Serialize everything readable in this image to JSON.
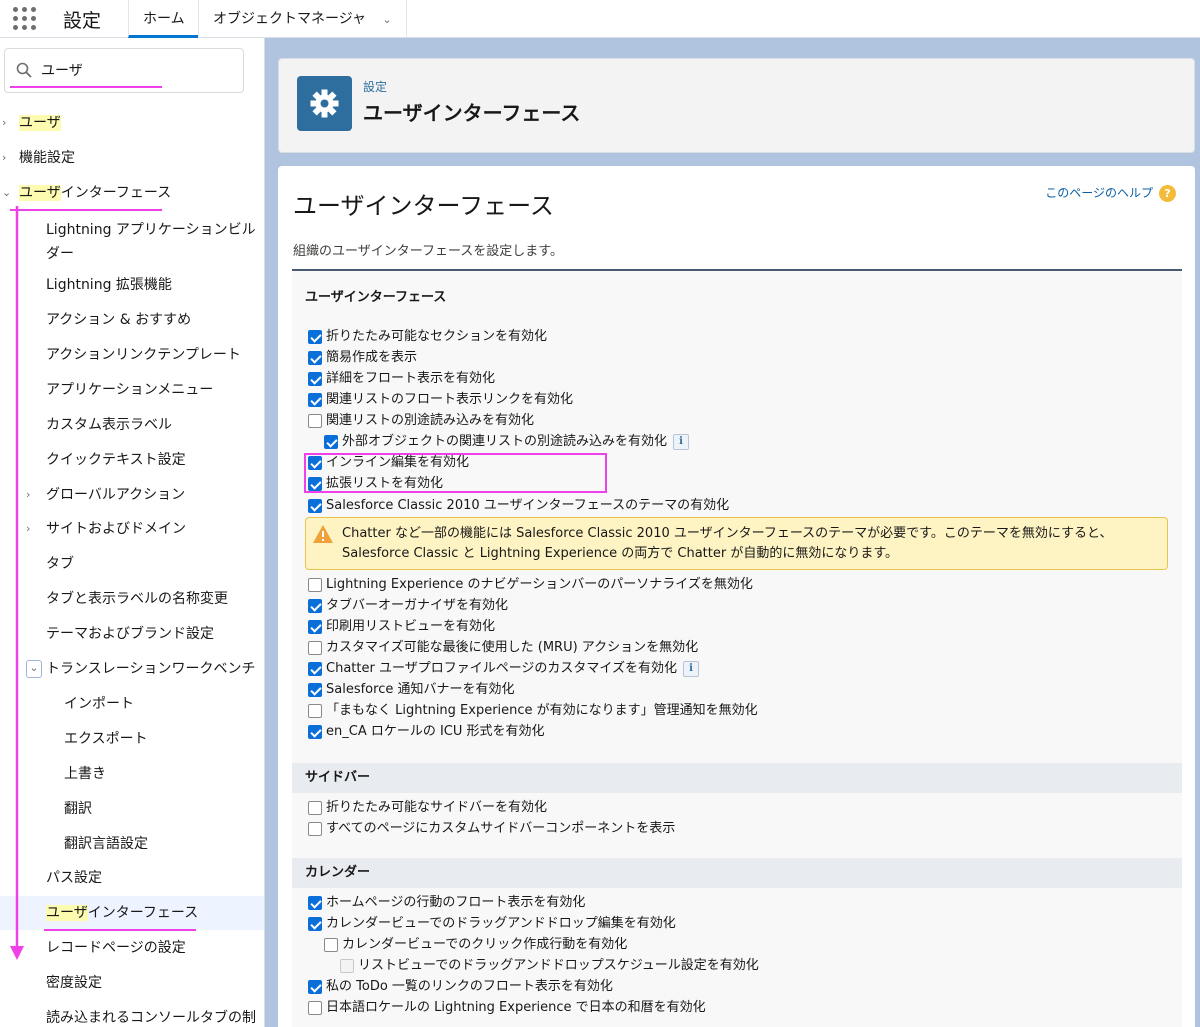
{
  "topbar": {
    "title": "設定",
    "tabs": [
      "ホーム",
      "オブジェクトマネージャ"
    ]
  },
  "search": {
    "value": "ユーザ",
    "icon": "search-icon"
  },
  "sidebar": {
    "items": [
      {
        "label": "ユーザ",
        "arrow": "›",
        "highlight": true
      },
      {
        "label": "機能設定",
        "arrow": "›"
      },
      {
        "label": "ユーザインターフェース",
        "arrow": "⌄",
        "highlight": true
      },
      {
        "label": "Lightning アプリケーションビル",
        "label2": "ダー"
      },
      {
        "label": "Lightning 拡張機能"
      },
      {
        "label": "アクション & おすすめ"
      },
      {
        "label": "アクションリンクテンプレート"
      },
      {
        "label": "アプリケーションメニュー"
      },
      {
        "label": "カスタム表示ラベル"
      },
      {
        "label": "クイックテキスト設定"
      },
      {
        "label": "グローバルアクション",
        "arrow": "›"
      },
      {
        "label": "サイトおよびドメイン",
        "arrow": "›"
      },
      {
        "label": "タブ"
      },
      {
        "label": "タブと表示ラベルの名称変更"
      },
      {
        "label": "テーマおよびブランド設定"
      },
      {
        "label": "トランスレーションワークベンチ",
        "arrow": "⌄"
      },
      {
        "label": "インポート"
      },
      {
        "label": "エクスポート"
      },
      {
        "label": "上書き"
      },
      {
        "label": "翻訳"
      },
      {
        "label": "翻訳言語設定"
      },
      {
        "label": "パス設定"
      },
      {
        "label": "ユーザインターフェース",
        "highlight": true,
        "selected": true
      },
      {
        "label": "レコードページの設定"
      },
      {
        "label": "密度設定"
      },
      {
        "label": "読み込まれるコンソールタブの制"
      }
    ]
  },
  "header": {
    "crumb": "設定",
    "title": "ユーザインターフェース",
    "icon": "gear-icon"
  },
  "content": {
    "title": "ユーザインターフェース",
    "help": "このページのヘルプ",
    "help_badge": "?",
    "description": "組織のユーザインターフェースを設定します。",
    "sections": {
      "ui": "ユーザインターフェース",
      "sidebar": "サイドバー",
      "calendar": "カレンダー"
    },
    "ui_options": [
      {
        "label": "折りたたみ可能なセクションを有効化",
        "checked": true
      },
      {
        "label": "簡易作成を表示",
        "checked": true
      },
      {
        "label": "詳細をフロート表示を有効化",
        "checked": true
      },
      {
        "label": "関連リストのフロート表示リンクを有効化",
        "checked": true
      },
      {
        "label": "関連リストの別途読み込みを有効化",
        "checked": false
      },
      {
        "label": "外部オブジェクトの関連リストの別途読み込みを有効化",
        "checked": true,
        "indent": 1,
        "info": true
      },
      {
        "label": "インライン編集を有効化",
        "checked": true
      },
      {
        "label": "拡張リストを有効化",
        "checked": true
      },
      {
        "label": "Salesforce Classic 2010 ユーザインターフェースのテーマの有効化",
        "checked": true
      },
      {
        "label": "Lightning Experience のナビゲーションバーのパーソナライズを無効化",
        "checked": false
      },
      {
        "label": "タブバーオーガナイザを有効化",
        "checked": true
      },
      {
        "label": "印刷用リストビューを有効化",
        "checked": true
      },
      {
        "label": "カスタマイズ可能な最後に使用した (MRU) アクションを無効化",
        "checked": false
      },
      {
        "label": "Chatter ユーザプロファイルページのカスタマイズを有効化",
        "checked": true,
        "info": true
      },
      {
        "label": "Salesforce 通知バナーを有効化",
        "checked": true
      },
      {
        "label": "「まもなく Lightning Experience が有効になります」管理通知を無効化",
        "checked": false
      },
      {
        "label": "en_CA ロケールの ICU 形式を有効化",
        "checked": true
      }
    ],
    "warning": "Chatter など一部の機能には Salesforce Classic 2010 ユーザインターフェースのテーマが必要です。このテーマを無効にすると、Salesforce Classic と Lightning Experience の両方で Chatter が自動的に無効になります。",
    "sidebar_options": [
      {
        "label": "折りたたみ可能なサイドバーを有効化",
        "checked": false
      },
      {
        "label": "すべてのページにカスタムサイドバーコンポーネントを表示",
        "checked": false
      }
    ],
    "calendar_options": [
      {
        "label": "ホームページの行動のフロート表示を有効化",
        "checked": true
      },
      {
        "label": "カレンダービューでのドラッグアンドドロップ編集を有効化",
        "checked": true
      },
      {
        "label": "カレンダービューでのクリック作成行動を有効化",
        "checked": false,
        "indent": 1
      },
      {
        "label": "リストビューでのドラッグアンドドロップスケジュール設定を有効化",
        "checked": false,
        "indent": 2,
        "disabled": true
      },
      {
        "label": "私の ToDo 一覧のリンクのフロート表示を有効化",
        "checked": true
      },
      {
        "label": "日本語ロケールの Lightning Experience で日本の和暦を有効化",
        "checked": false
      }
    ]
  },
  "colors": {
    "accent": "#0a6fd8",
    "annotation": "#f040e8",
    "highlight": "#fdfbb0"
  }
}
